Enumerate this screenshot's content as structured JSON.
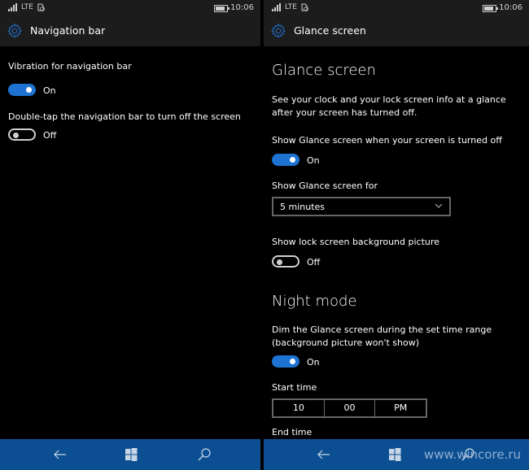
{
  "status_bar": {
    "network": "LTE",
    "time": "10:06"
  },
  "left": {
    "header_title": "Navigation bar",
    "settings": [
      {
        "label": "Vibration for navigation bar",
        "state": "On"
      },
      {
        "label": "Double-tap the navigation bar to turn off the screen",
        "state": "Off"
      }
    ]
  },
  "right": {
    "header_title": "Glance screen",
    "section1_title": "Glance screen",
    "section1_desc": "See your clock and your lock screen info at a glance after your screen has turned off.",
    "show_glance_label": "Show Glance screen when your screen is turned off",
    "show_glance_state": "On",
    "show_for_label": "Show Glance screen for",
    "show_for_value": "5 minutes",
    "bg_picture_label": "Show lock screen background picture",
    "bg_picture_state": "Off",
    "section2_title": "Night mode",
    "night_desc": "Dim the Glance screen during the set time range (background picture won't show)",
    "night_state": "On",
    "start_time_label": "Start time",
    "start_time": {
      "hour": "10",
      "minute": "00",
      "period": "PM"
    },
    "end_time_label": "End time"
  },
  "navbar": {
    "buttons": [
      "back",
      "start",
      "search"
    ]
  },
  "watermark": "www.wincore.ru",
  "colors": {
    "accent": "#1e73d2",
    "navbar": "#0b4f92",
    "header": "#1c1c1c"
  }
}
